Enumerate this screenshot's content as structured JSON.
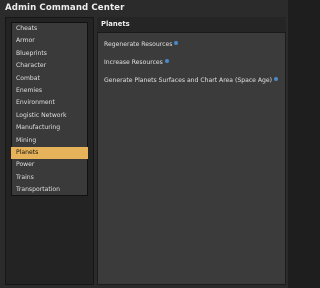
{
  "window": {
    "title": "Admin Command Center"
  },
  "sidebar": {
    "items": [
      {
        "label": "Cheats"
      },
      {
        "label": "Armor"
      },
      {
        "label": "Blueprints"
      },
      {
        "label": "Character"
      },
      {
        "label": "Combat"
      },
      {
        "label": "Enemies"
      },
      {
        "label": "Environment"
      },
      {
        "label": "Logistic Network"
      },
      {
        "label": "Manufacturing"
      },
      {
        "label": "Mining"
      },
      {
        "label": "Planets"
      },
      {
        "label": "Power"
      },
      {
        "label": "Trains"
      },
      {
        "label": "Transportation"
      }
    ],
    "selected": "Planets"
  },
  "main": {
    "title": "Planets",
    "actions": [
      {
        "label": "Regenerate Resources",
        "icon": "info-icon"
      },
      {
        "label": "Increase Resources",
        "icon": "info-icon"
      },
      {
        "label": "Generate Planets Surfaces and Chart Area (Space Age)",
        "icon": "info-icon"
      }
    ]
  },
  "colors": {
    "selected_bg": "#e6b35a",
    "info_icon": "#4a88c7"
  }
}
